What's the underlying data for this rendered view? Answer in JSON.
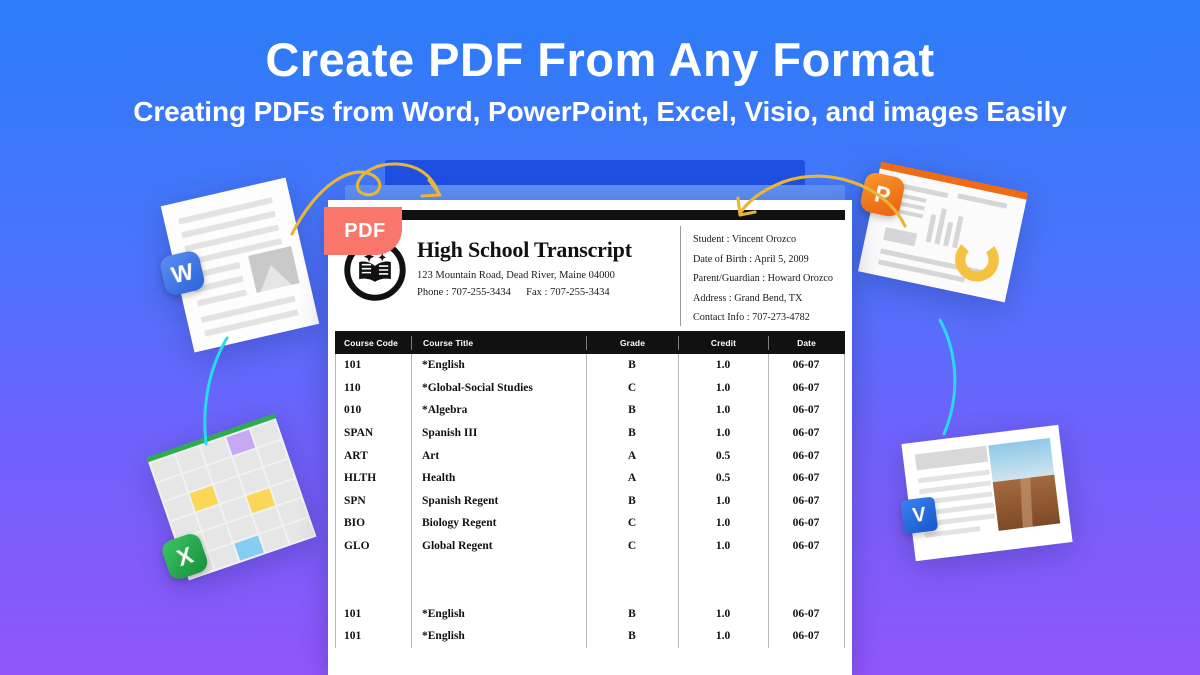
{
  "hero": {
    "title": "Create PDF From Any Format",
    "subtitle": "Creating PDFs from Word, PowerPoint, Excel, Visio, and images Easily"
  },
  "colors": {
    "bg_top": "#2b7cf8",
    "bg_bottom": "#9156fa",
    "pdf_flag": "#f8766c",
    "arrow_gold": "#e8b537",
    "arc_cyan": "#2ad8f0",
    "word_blue": "#2b63d8",
    "excel_green": "#168f3a",
    "ppt_orange": "#e85f0c",
    "visio_blue": "#1756c8"
  },
  "pdf_flag": {
    "label": "PDF"
  },
  "document": {
    "school": {
      "title": "High School Transcript",
      "address": "123 Mountain Road, Dead River, Maine 04000",
      "phone_label": "Phone :",
      "phone": "707-255-3434",
      "fax_label": "Fax :",
      "fax": "707-255-3434",
      "emblem_icon": "open-book-emblem-icon"
    },
    "student_meta": [
      "Student : Vincent Orozco",
      "Date of Birth : April 5,  2009",
      "Parent/Guardian : Howard Orozco",
      "Address : Grand Bend, TX",
      "Contact Info : 707-273-4782"
    ],
    "table": {
      "columns": [
        "Course Code",
        "Course Title",
        "Grade",
        "Credit",
        "Date"
      ],
      "rows": [
        {
          "code": "101",
          "title": "*English",
          "grade": "B",
          "credit": "1.0",
          "date": "06-07"
        },
        {
          "code": "110",
          "title": "*Global-Social Studies",
          "grade": "C",
          "credit": "1.0",
          "date": "06-07"
        },
        {
          "code": "010",
          "title": "*Algebra",
          "grade": "B",
          "credit": "1.0",
          "date": "06-07"
        },
        {
          "code": "SPAN",
          "title": "Spanish III",
          "grade": "B",
          "credit": "1.0",
          "date": "06-07"
        },
        {
          "code": "ART",
          "title": "Art",
          "grade": "A",
          "credit": "0.5",
          "date": "06-07"
        },
        {
          "code": "HLTH",
          "title": "Health",
          "grade": "A",
          "credit": "0.5",
          "date": "06-07"
        },
        {
          "code": "SPN",
          "title": "Spanish Regent",
          "grade": "B",
          "credit": "1.0",
          "date": "06-07"
        },
        {
          "code": "BIO",
          "title": "Biology Regent",
          "grade": "C",
          "credit": "1.0",
          "date": "06-07"
        },
        {
          "code": "GLO",
          "title": "Global Regent",
          "grade": "C",
          "credit": "1.0",
          "date": "06-07"
        }
      ],
      "rows_after_gap": [
        {
          "code": "101",
          "title": "*English",
          "grade": "B",
          "credit": "1.0",
          "date": "06-07"
        },
        {
          "code": "101",
          "title": "*English",
          "grade": "B",
          "credit": "1.0",
          "date": "06-07"
        }
      ]
    }
  },
  "office_cards": [
    {
      "id": "word",
      "badge_letter": "W",
      "icon": "word-document-icon"
    },
    {
      "id": "excel",
      "badge_letter": "X",
      "icon": "excel-spreadsheet-icon"
    },
    {
      "id": "ppt",
      "badge_letter": "P",
      "icon": "powerpoint-slide-icon"
    },
    {
      "id": "visio",
      "badge_letter": "V",
      "icon": "visio-document-icon"
    }
  ]
}
